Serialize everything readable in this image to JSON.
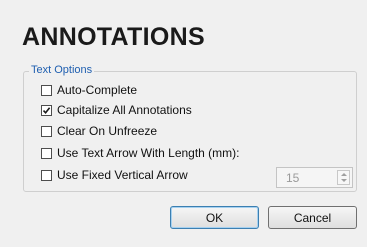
{
  "dialog": {
    "title": "ANNOTATIONS",
    "group_label": "Text Options",
    "options": [
      {
        "label": "Auto-Complete",
        "checked": false
      },
      {
        "label": "Capitalize All Annotations",
        "checked": true
      },
      {
        "label": "Clear On Unfreeze",
        "checked": false
      },
      {
        "label": "Use Text Arrow With Length (mm):",
        "checked": false
      },
      {
        "label": "Use Fixed Vertical Arrow",
        "checked": false
      }
    ],
    "arrow_length": {
      "value": "15",
      "enabled": false
    },
    "ok_label": "OK",
    "cancel_label": "Cancel"
  },
  "colors": {
    "legend_text": "#1f5fb0",
    "ok_border": "#3c7fb1"
  },
  "icons": {
    "checkmark": "check-icon",
    "spin_up": "chevron-up-icon",
    "spin_down": "chevron-down-icon"
  }
}
